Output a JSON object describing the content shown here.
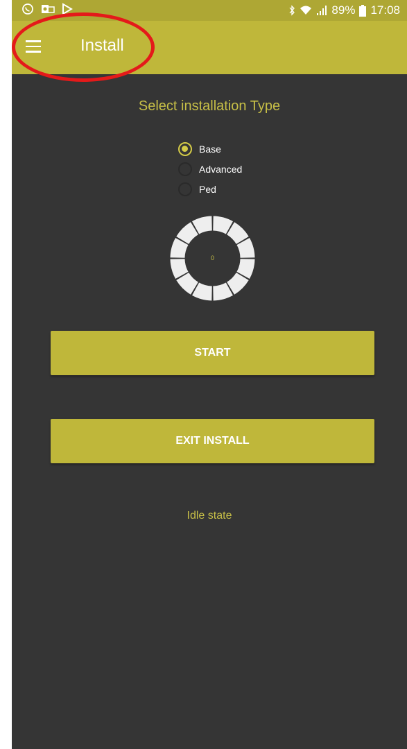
{
  "status_bar": {
    "time": "17:08",
    "battery": "89%",
    "icons": [
      "whatsapp-icon",
      "outlook-icon",
      "play-store-icon",
      "bluetooth-icon",
      "wifi-icon",
      "signal-icon",
      "battery-icon"
    ]
  },
  "app_bar": {
    "title": "Install",
    "menu_icon": "hamburger-menu-icon"
  },
  "install": {
    "section_title": "Select installation Type",
    "options": [
      {
        "label": "Base",
        "selected": true
      },
      {
        "label": "Advanced",
        "selected": false
      },
      {
        "label": "Ped",
        "selected": false
      }
    ],
    "dial_value": "0",
    "start_label": "START",
    "exit_label": "EXIT INSTALL",
    "state": "Idle state"
  },
  "colors": {
    "accent": "#bfb73a",
    "background": "#353535",
    "annotation": "#e41a1a"
  }
}
